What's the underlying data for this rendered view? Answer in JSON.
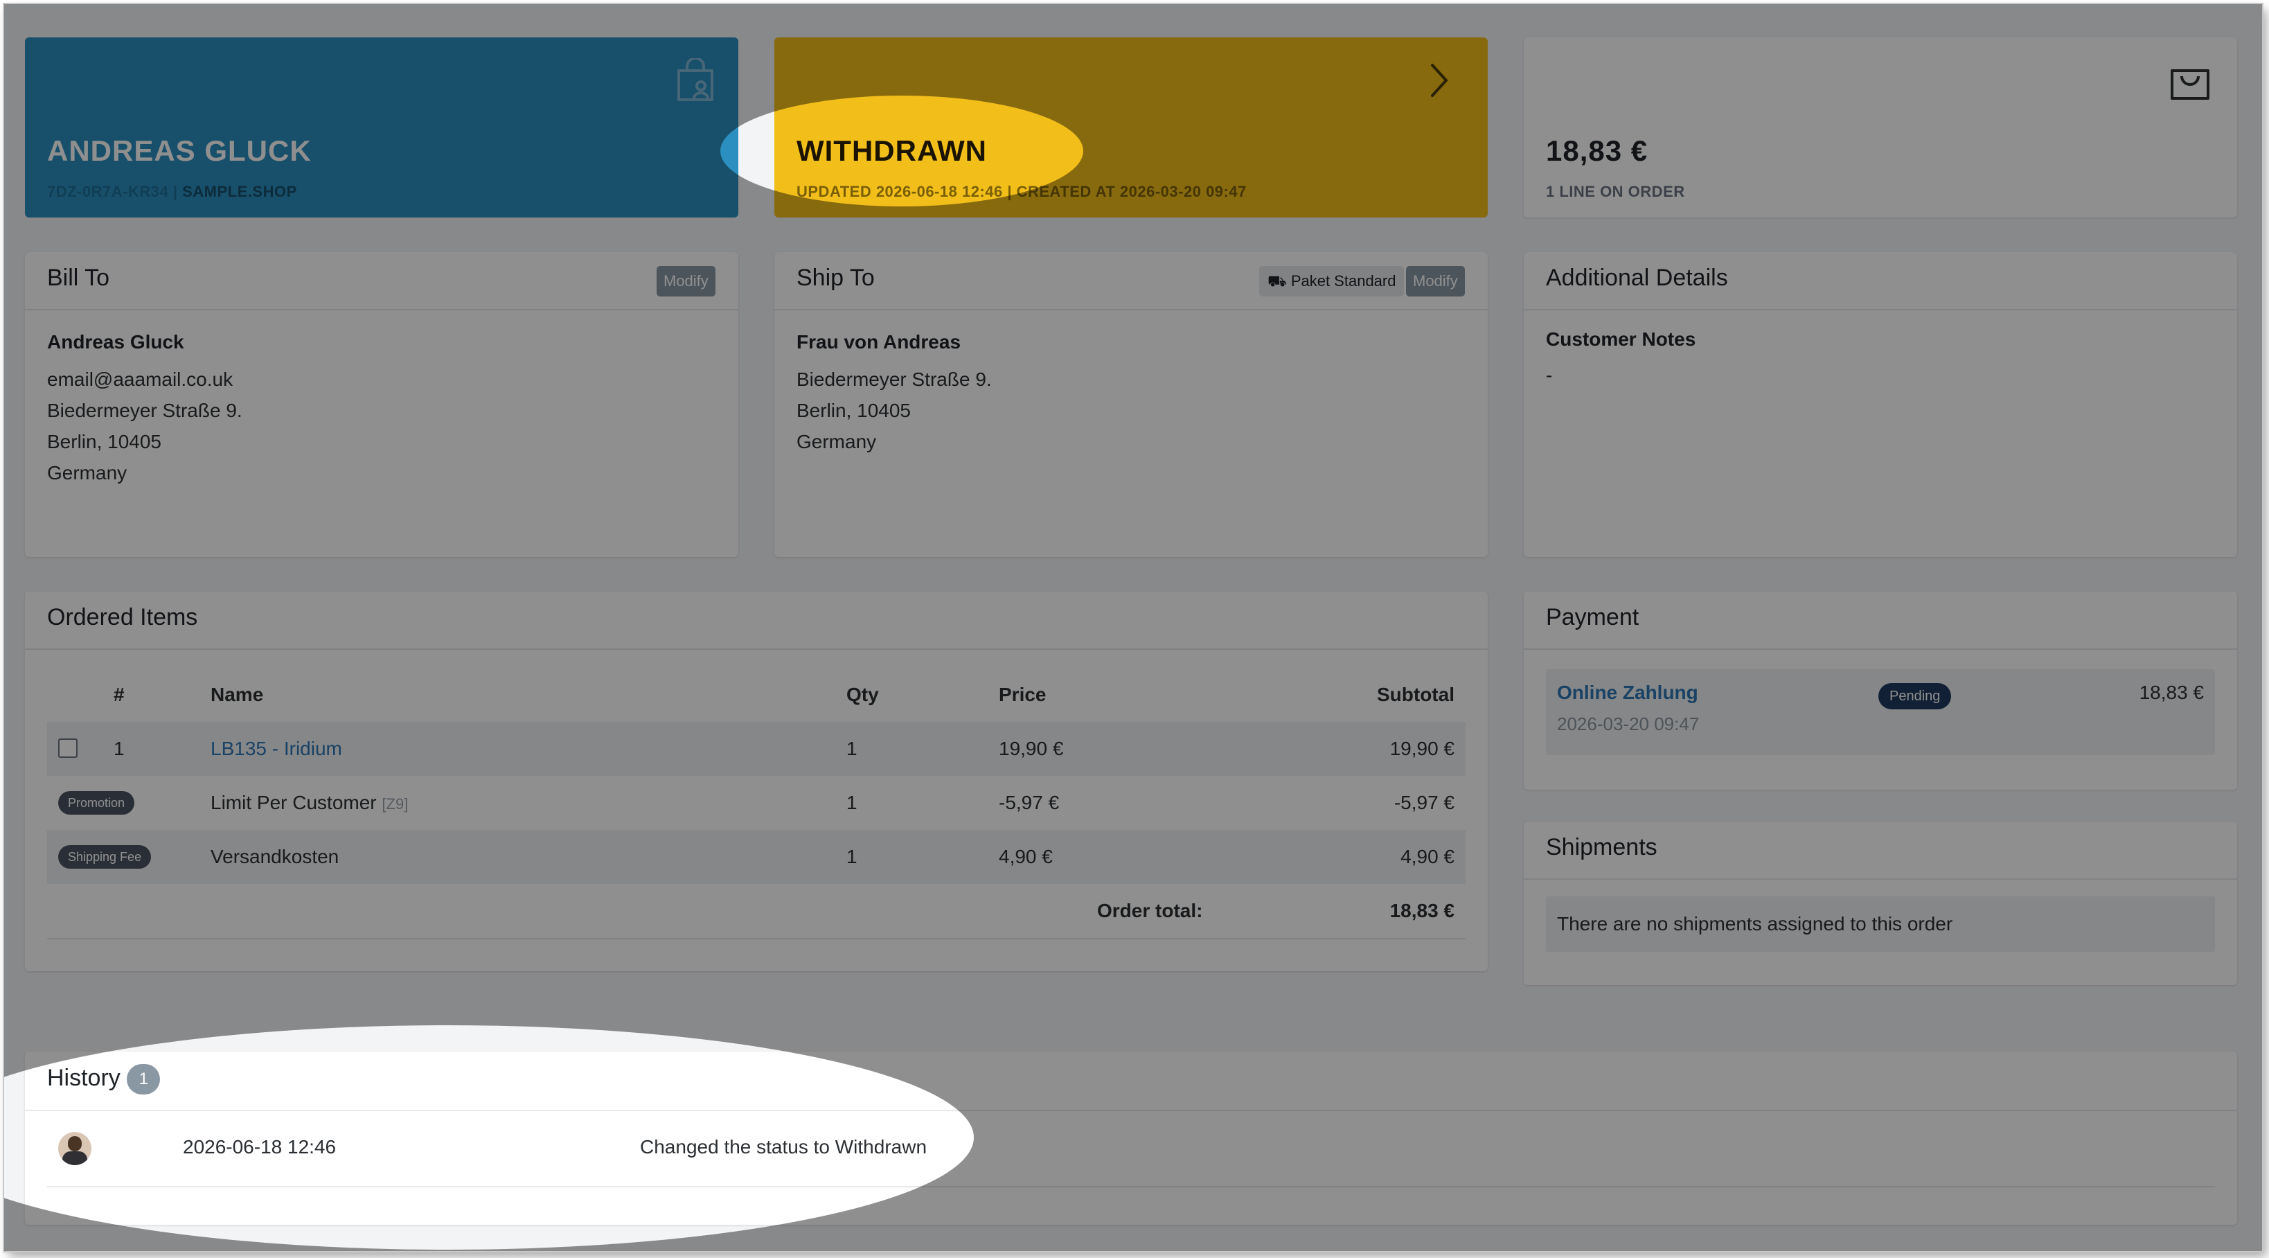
{
  "customer_card": {
    "name": "ANDREAS GLUCK",
    "id": "7DZ-0R7A-KR34",
    "separator": " | ",
    "shop": "SAMPLE.SHOP",
    "color": "#2b8fbf"
  },
  "status_card": {
    "status": "WITHDRAWN",
    "meta": "UPDATED 2026-06-18 12:46 | CREATED AT 2026-03-20 09:47",
    "color": "#f5c518"
  },
  "total_card": {
    "amount": "18,83 €",
    "lines": "1 LINE ON ORDER"
  },
  "bill_to": {
    "title": "Bill To",
    "modify": "Modify",
    "name": "Andreas Gluck",
    "lines": [
      "email@aaamail.co.uk",
      "Biedermeyer Straße 9.",
      "Berlin, 10405",
      "Germany"
    ]
  },
  "ship_to": {
    "title": "Ship To",
    "shipping_method": "Paket Standard",
    "modify": "Modify",
    "name": "Frau von Andreas",
    "lines": [
      "Biedermeyer Straße 9.",
      "Berlin, 10405",
      "Germany"
    ]
  },
  "additional": {
    "title": "Additional Details",
    "notes_label": "Customer Notes",
    "notes_value": "-"
  },
  "ordered_items": {
    "title": "Ordered Items",
    "headers": {
      "num": "#",
      "name": "Name",
      "qty": "Qty",
      "price": "Price",
      "subtotal": "Subtotal"
    },
    "rows": [
      {
        "num": "1",
        "name": "LB135 - Iridium",
        "qty": "1",
        "price": "19,90 €",
        "subtotal": "19,90 €"
      },
      {
        "badge": "Promotion",
        "name": "Limit Per Customer",
        "code": "[Z9]",
        "qty": "1",
        "price": "-5,97 €",
        "subtotal": "-5,97 €"
      },
      {
        "badge": "Shipping Fee",
        "name": "Versandkosten",
        "qty": "1",
        "price": "4,90 €",
        "subtotal": "4,90 €"
      }
    ],
    "total_label": "Order total:",
    "total_value": "18,83 €"
  },
  "payment": {
    "title": "Payment",
    "method": "Online Zahlung",
    "date": "2026-03-20 09:47",
    "status": "Pending",
    "amount": "18,83 €"
  },
  "shipments": {
    "title": "Shipments",
    "empty": "There are no shipments assigned to this order"
  },
  "history": {
    "title": "History",
    "count": "1",
    "entries": [
      {
        "date": "2026-06-18 12:46",
        "text": "Changed the status to Withdrawn"
      }
    ]
  },
  "icons": {
    "customer": "shopping-bag-user-icon",
    "status": "chevron-right-icon",
    "total": "shopping-bag-icon",
    "shipping": "truck-icon"
  }
}
